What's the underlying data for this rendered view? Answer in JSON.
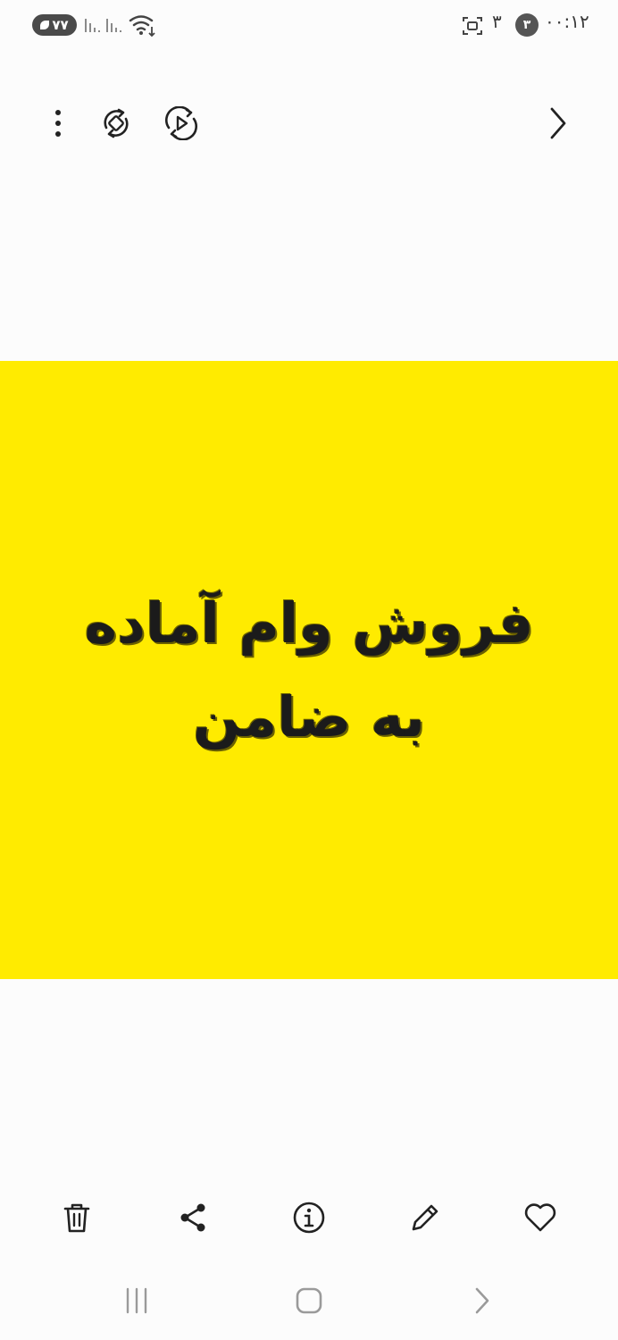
{
  "status_bar": {
    "battery_level": "۷۷",
    "time": "۰۰:۱۲",
    "notification_count": "۳",
    "indicator_char": "۳"
  },
  "toolbar": {
    "icons": [
      "more-options-icon",
      "rotate-icon",
      "motion-photo-icon",
      "forward-chevron-icon"
    ]
  },
  "image": {
    "background_color": "#ffeb00",
    "text_line_1": "فروش وام آماده",
    "text_line_2": "به ضامن"
  },
  "actions": {
    "icons": [
      "delete-icon",
      "share-icon",
      "info-icon",
      "edit-icon",
      "favorite-icon"
    ]
  },
  "nav_bar": {
    "icons": [
      "recents-icon",
      "home-icon",
      "back-icon"
    ]
  }
}
